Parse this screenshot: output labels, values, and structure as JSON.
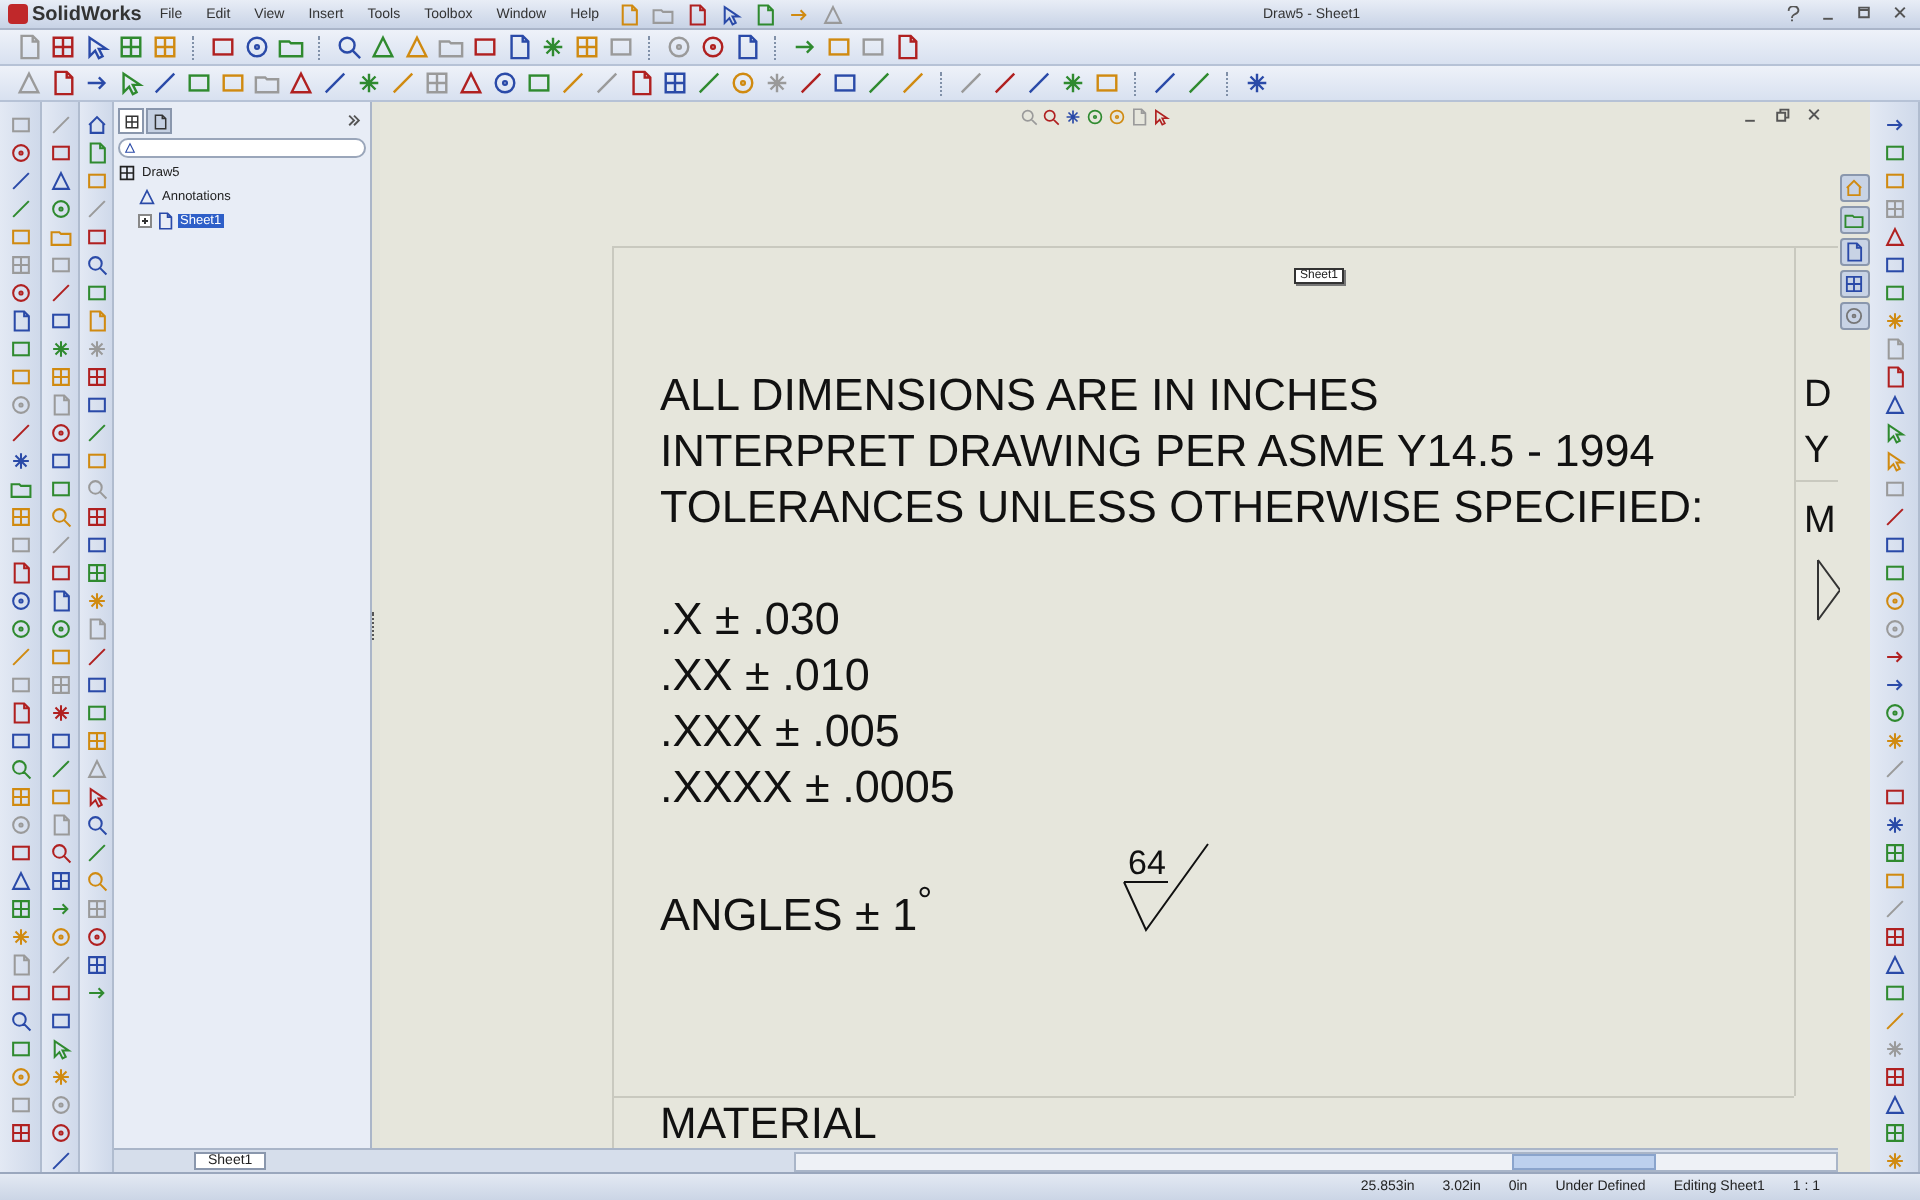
{
  "app": {
    "name": "SolidWorks"
  },
  "menu": [
    "File",
    "Edit",
    "View",
    "Insert",
    "Tools",
    "Toolbox",
    "Window",
    "Help"
  ],
  "window": {
    "title": "Draw5 - Sheet1"
  },
  "feature_tree": {
    "tabs": [
      {
        "selected": true
      },
      {
        "selected": false
      }
    ],
    "items": [
      {
        "label": "Draw5",
        "selected": false,
        "children": [
          {
            "label": "Annotations",
            "selected": false
          },
          {
            "label": "Sheet1",
            "selected": true,
            "expanded": false
          }
        ]
      }
    ]
  },
  "sheet": {
    "tag": "Sheet1",
    "notes": [
      [
        "ALL DIMENSIONS ARE IN INCHES",
        "INTERPRET DRAWING PER ASME Y14.5 - 1994",
        "TOLERANCES UNLESS OTHERWISE SPECIFIED:"
      ],
      [
        ".X ± .030",
        ".XX ± .010",
        ".XXX ± .005",
        ".XXXX ± .0005"
      ],
      [
        "ANGLES ± 1$^{°}$"
      ]
    ],
    "roughness": "64",
    "right_column": [
      "D",
      "Y",
      "M"
    ],
    "bottom_label": "MATERIAL"
  },
  "sheet_tabs": [
    {
      "label": "Sheet1",
      "selected": true
    }
  ],
  "status_bar": [
    "25.853in",
    "3.02in",
    "0in",
    "Under Defined",
    "Editing Sheet1",
    "1 : 1"
  ]
}
